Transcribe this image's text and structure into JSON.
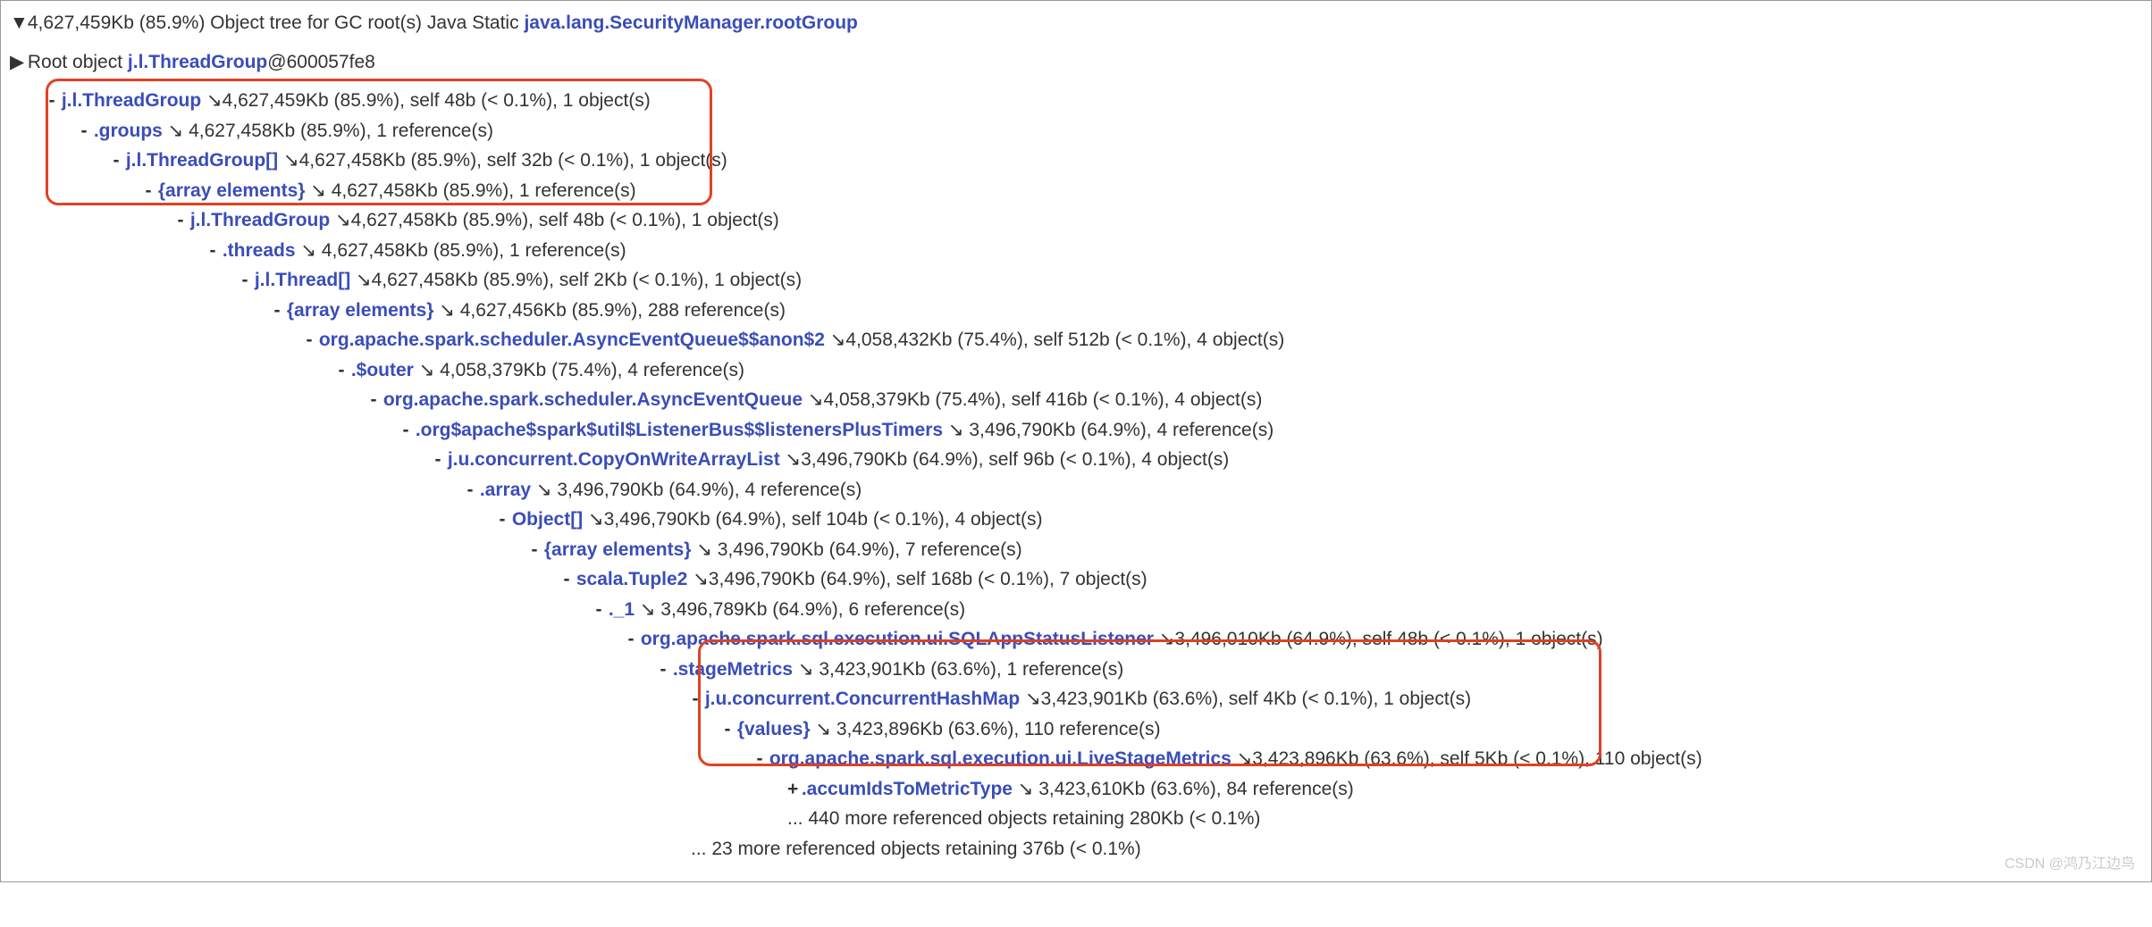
{
  "header": {
    "prefix": "4,627,459Kb (85.9%) Object tree for GC root(s) Java Static ",
    "root_link": "java.lang.SecurityManager.rootGroup"
  },
  "root_object": {
    "prefix": "Root object ",
    "link": "j.l.ThreadGroup",
    "suffix": "@600057fe8"
  },
  "tree": {
    "n0": {
      "link": "j.l.ThreadGroup",
      "stats": " ↘4,627,459Kb (85.9%), self 48b (< 0.1%), 1 object(s)"
    },
    "n1": {
      "link": ".groups",
      "stats": " ↘ 4,627,458Kb (85.9%), 1 reference(s)"
    },
    "n2": {
      "link": "j.l.ThreadGroup[]",
      "stats": " ↘4,627,458Kb (85.9%), self 32b (< 0.1%), 1 object(s)"
    },
    "n3": {
      "link": "{array elements}",
      "stats": " ↘ 4,627,458Kb (85.9%), 1 reference(s)"
    },
    "n4": {
      "link": "j.l.ThreadGroup",
      "stats": " ↘4,627,458Kb (85.9%), self 48b (< 0.1%), 1 object(s)"
    },
    "n5": {
      "link": ".threads",
      "stats": " ↘ 4,627,458Kb (85.9%), 1 reference(s)"
    },
    "n6": {
      "link": "j.l.Thread[]",
      "stats": " ↘4,627,458Kb (85.9%), self 2Kb (< 0.1%), 1 object(s)"
    },
    "n7": {
      "link": "{array elements}",
      "stats": " ↘ 4,627,456Kb (85.9%), 288 reference(s)"
    },
    "n8": {
      "link": "org.apache.spark.scheduler.AsyncEventQueue$$anon$2",
      "stats": " ↘4,058,432Kb (75.4%), self 512b (< 0.1%), 4 object(s)"
    },
    "n9": {
      "link": ".$outer",
      "stats": " ↘ 4,058,379Kb (75.4%), 4 reference(s)"
    },
    "n10": {
      "link": "org.apache.spark.scheduler.AsyncEventQueue",
      "stats": " ↘4,058,379Kb (75.4%), self 416b (< 0.1%), 4 object(s)"
    },
    "n11": {
      "link": ".org$apache$spark$util$ListenerBus$$listenersPlusTimers",
      "stats": " ↘ 3,496,790Kb (64.9%), 4 reference(s)"
    },
    "n12": {
      "link": "j.u.concurrent.CopyOnWriteArrayList",
      "stats": " ↘3,496,790Kb (64.9%), self 96b (< 0.1%), 4 object(s)"
    },
    "n13": {
      "link": ".array",
      "stats": " ↘ 3,496,790Kb (64.9%), 4 reference(s)"
    },
    "n14": {
      "link": "Object[]",
      "stats": " ↘3,496,790Kb (64.9%), self 104b (< 0.1%), 4 object(s)"
    },
    "n15": {
      "link": "{array elements}",
      "stats": " ↘ 3,496,790Kb (64.9%), 7 reference(s)"
    },
    "n16": {
      "link": "scala.Tuple2",
      "stats": " ↘3,496,790Kb (64.9%), self 168b (< 0.1%), 7 object(s)"
    },
    "n17": {
      "link": "._1",
      "stats": " ↘ 3,496,789Kb (64.9%), 6 reference(s)"
    },
    "n18": {
      "link": "org.apache.spark.sql.execution.ui.SQLAppStatusListener",
      "stats": " ↘3,496,010Kb (64.9%), self 48b (< 0.1%), 1 object(s)"
    },
    "n19": {
      "link": ".stageMetrics",
      "stats": " ↘ 3,423,901Kb (63.6%), 1 reference(s)"
    },
    "n20": {
      "link": "j.u.concurrent.ConcurrentHashMap",
      "stats": " ↘3,423,901Kb (63.6%), self 4Kb (< 0.1%), 1 object(s)"
    },
    "n21": {
      "link": "{values}",
      "stats": " ↘ 3,423,896Kb (63.6%), 110 reference(s)"
    },
    "n22": {
      "link": "org.apache.spark.sql.execution.ui.LiveStageMetrics",
      "stats": " ↘3,423,896Kb (63.6%), self 5Kb (< 0.1%), 110 object(s)"
    },
    "n23": {
      "link": ".accumIdsToMetricType",
      "stats": " ↘ 3,423,610Kb (63.6%), 84 reference(s)"
    },
    "more24": "... 440 more referenced objects retaining 280Kb (< 0.1%)",
    "more25": "... 23 more referenced objects retaining 376b (< 0.1%)"
  },
  "watermark": "CSDN @鸿乃江边鸟"
}
